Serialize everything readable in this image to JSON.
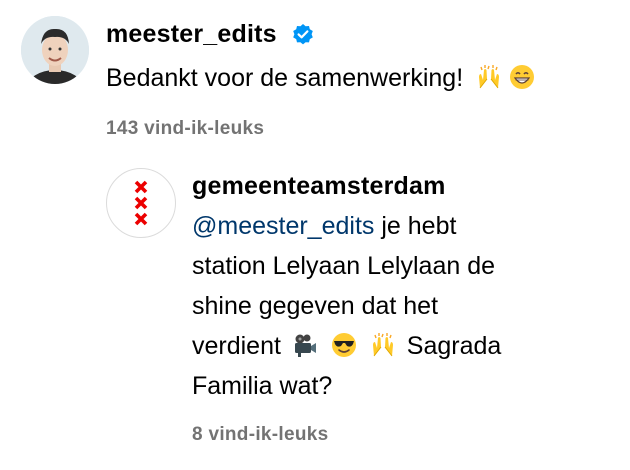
{
  "main_comment": {
    "username": "meester_edits",
    "verified": true,
    "text": "Bedankt voor de samenwerking!",
    "emojis": [
      "raising-hands",
      "grinning-face"
    ],
    "likes": "143 vind-ik-leuks"
  },
  "reply": {
    "username": "gemeenteamsterdam",
    "mention": "@meester_edits",
    "line1_rest": " je hebt",
    "line2": "station Lelyaan Lelylaan de",
    "line3": "shine gegeven dat het",
    "line4_start": "verdient",
    "line4_end": "Sagrada",
    "line5": "Familia wat?",
    "emojis": [
      "movie-camera",
      "sunglasses-face",
      "raising-hands"
    ],
    "likes": "8 vind-ik-leuks"
  },
  "colors": {
    "mention": "#00376b",
    "muted": "#737373",
    "verified": "#0095f6",
    "amsterdam_red": "#ec0000"
  }
}
